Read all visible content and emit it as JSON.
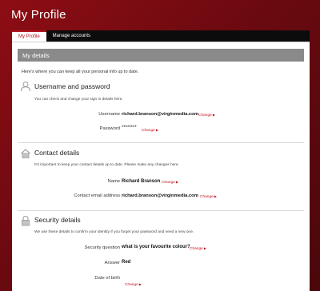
{
  "header": {
    "title": "My Profile"
  },
  "tabs": [
    {
      "label": "My Profile",
      "active": true
    },
    {
      "label": "Manage accounts",
      "active": false
    }
  ],
  "details_bar": "My details",
  "intro": "Here's where you can keep all your personal info up to date.",
  "change_label": "Change",
  "sections": {
    "username": {
      "title": "Username and password",
      "desc": "You can check and change your sign in details here.",
      "username_label": "Username",
      "username_value": "richard.branson@virginmedia.com",
      "password_label": "Password",
      "password_value": "********"
    },
    "contact": {
      "title": "Contact details",
      "desc": "It's important to keep your contact details up to date. Please make any changes here.",
      "name_label": "Name",
      "name_value": "Richard Branson",
      "email_label": "Contact email address",
      "email_value": "richard.branson@virginmedia.com"
    },
    "security": {
      "title": "Security details",
      "desc": "We use these details to confirm your identity if you forget your password and need a new one.",
      "question_label": "Security question",
      "question_value": "what is your favourite colour?",
      "answer_label": "Answer",
      "answer_value": "Red",
      "dob_label": "Date of birth"
    }
  },
  "colors": {
    "brand_red": "#b0141f",
    "bar_grey": "#8a8a8a",
    "link_red": "#c0141f"
  }
}
